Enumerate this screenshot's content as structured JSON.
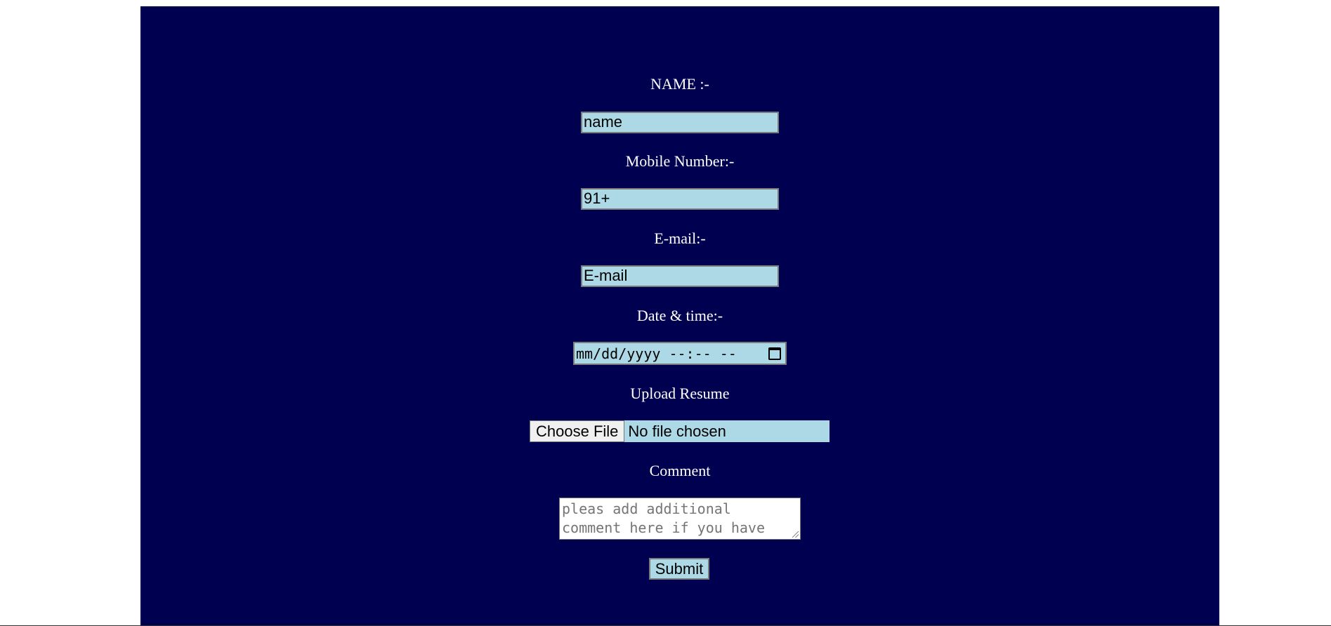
{
  "form": {
    "name_label": "NAME :-",
    "name_value": "name",
    "mobile_label": "Mobile Number:-",
    "mobile_value": "91+",
    "email_label": "E-mail:-",
    "email_value": "E-mail",
    "datetime_label": "Date & time:-",
    "datetime_value": "mm/dd/yyyy --:-- --",
    "upload_label": "Upload Resume",
    "choose_file_label": "Choose File",
    "file_status": "No file chosen",
    "comment_label": "Comment",
    "comment_placeholder": "pleas add additional comment here if you have",
    "submit_label": "Submit"
  },
  "colors": {
    "panel_background": "#000050",
    "field_background": "#add8e6",
    "label_text": "#ffffff"
  },
  "icons": {
    "datetime_picker": "calendar-icon"
  }
}
